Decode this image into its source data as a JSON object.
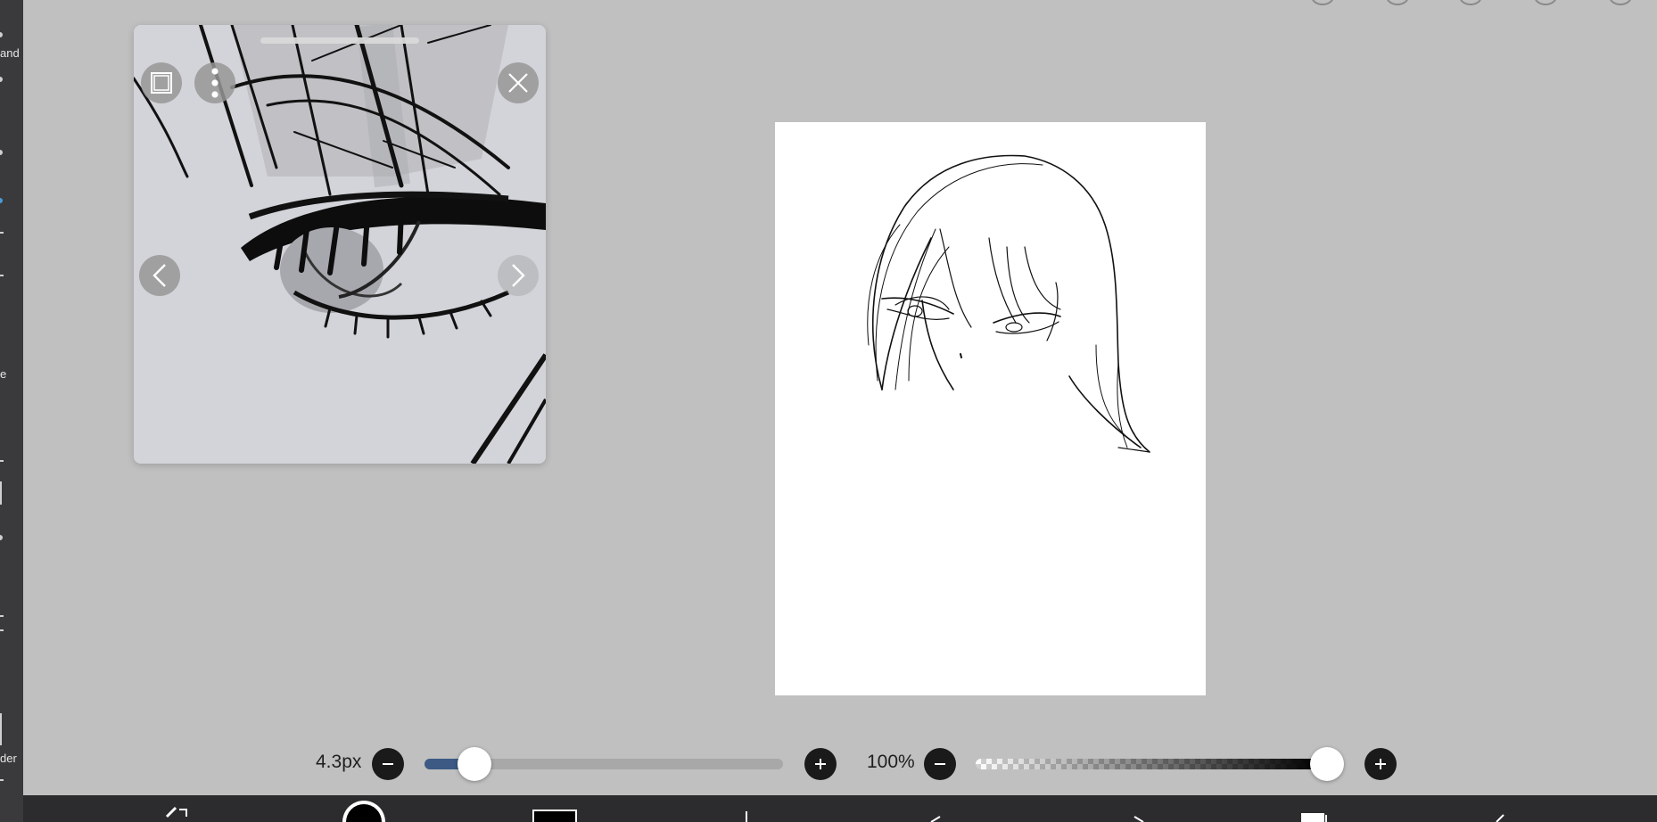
{
  "left_toolbar": {
    "labels": [
      "and",
      "e",
      "der"
    ]
  },
  "reference_viewer": {
    "frame_icon": "frame-icon",
    "menu_icon": "vertical-dots-icon",
    "close_icon": "close-icon",
    "prev_icon": "chevron-left-icon",
    "next_icon": "chevron-right-icon"
  },
  "brush": {
    "size_label": "4.3px",
    "size_fraction": 0.14
  },
  "opacity": {
    "label": "100%",
    "value_fraction": 1.0
  },
  "bottom_toolbar": {
    "icons": [
      "undo-icon",
      "brush-tip-icon",
      "color-swatch-icon",
      "divider-icon",
      "back-arrow-icon",
      "forward-arrow-icon",
      "layers-icon",
      "check-icon"
    ],
    "color_swatch": "#000000"
  },
  "colors": {
    "background": "#c0c0c0",
    "slider_fill": "#3c5a84",
    "toolbar": "#2c2c2e"
  }
}
